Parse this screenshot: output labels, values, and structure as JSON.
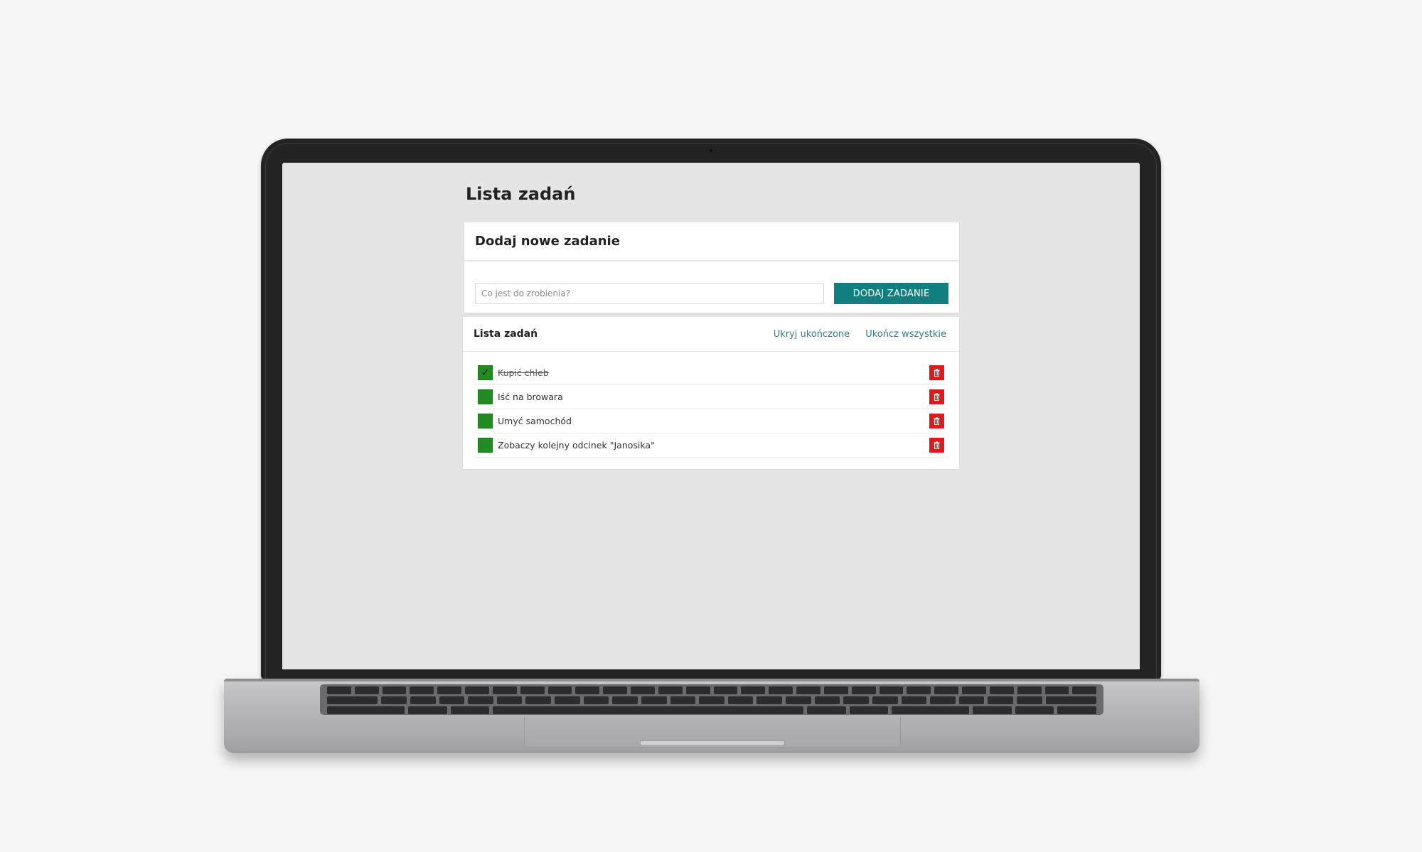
{
  "page": {
    "title": "Lista zadań"
  },
  "add_card": {
    "title": "Dodaj nowe zadanie",
    "input_value": "",
    "input_placeholder": "Co jest do zrobienia?",
    "button_label": "DODAJ ZADANIE"
  },
  "list_card": {
    "title": "Lista zadań",
    "hide_completed_label": "Ukryj ukończone",
    "complete_all_label": "Ukończ wszystkie"
  },
  "tasks": [
    {
      "label": "Kupić chleb",
      "done": true
    },
    {
      "label": "Iść na browara",
      "done": false
    },
    {
      "label": "Umyć samochód",
      "done": false
    },
    {
      "label": "Zobaczy kolejny odcinek \"Janosika\"",
      "done": false
    }
  ],
  "icons": {
    "checkbox": "checkmark-icon",
    "delete": "trash-icon"
  },
  "colors": {
    "accent": "#117f7f",
    "link": "#2e7d86",
    "checkbox": "#228b22",
    "delete": "#e0191c",
    "screen_background": "#e5e5e5"
  }
}
